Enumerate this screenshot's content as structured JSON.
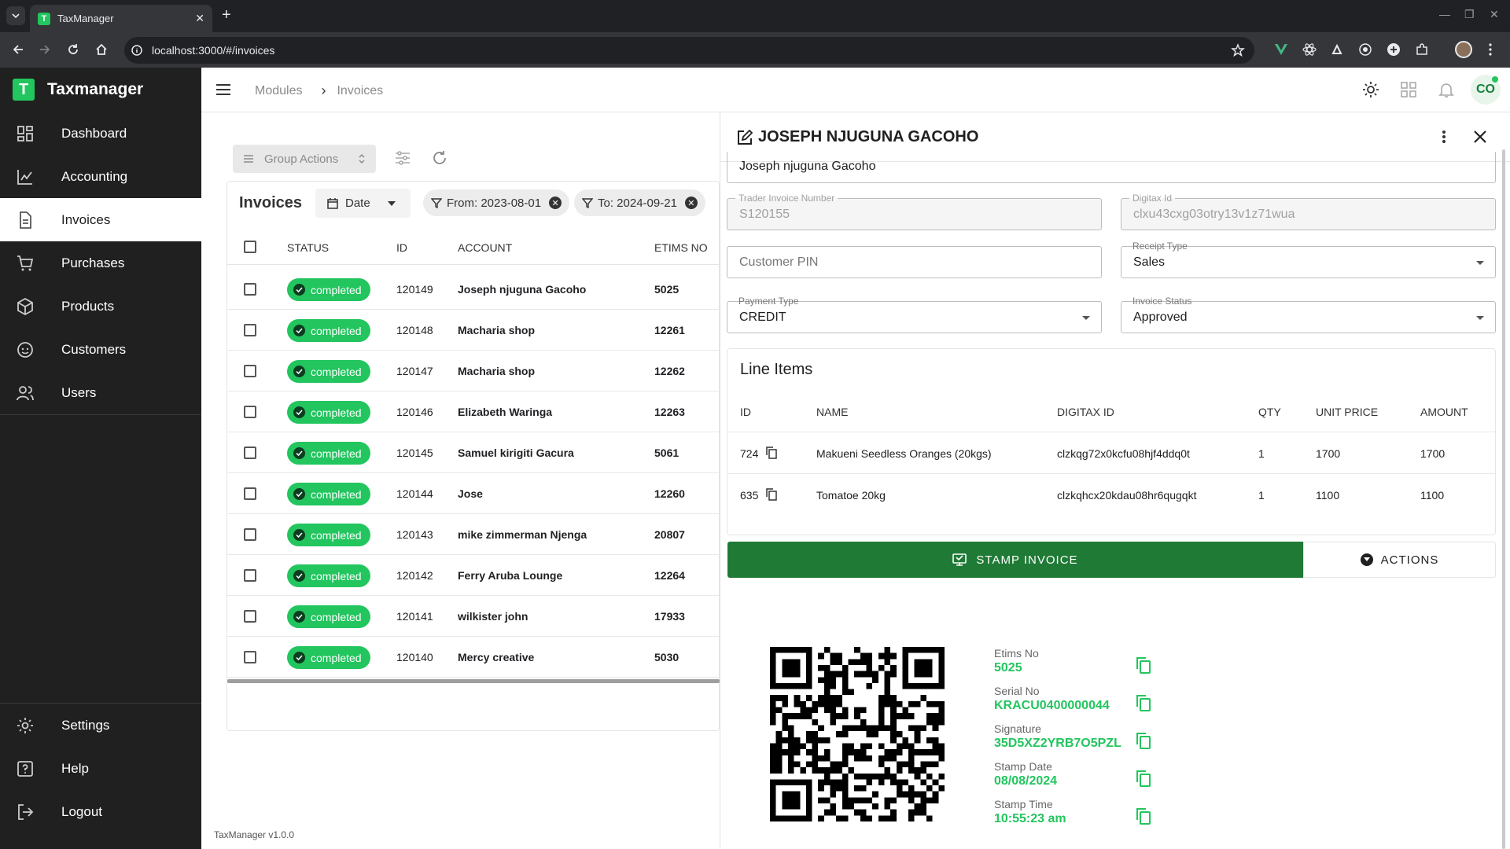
{
  "browser": {
    "tab_title": "TaxManager",
    "tab_favicon": "T",
    "url": "localhost:3000/#/invoices"
  },
  "app": {
    "brand": "Taxmanager",
    "brand_logo": "T",
    "version": "TaxManager v1.0.0"
  },
  "sidebar": {
    "items": [
      {
        "label": "Dashboard",
        "icon": "dashboard-icon"
      },
      {
        "label": "Accounting",
        "icon": "chart-icon"
      },
      {
        "label": "Invoices",
        "icon": "document-icon",
        "active": true
      },
      {
        "label": "Purchases",
        "icon": "cart-icon"
      },
      {
        "label": "Products",
        "icon": "cube-icon"
      },
      {
        "label": "Customers",
        "icon": "face-icon"
      },
      {
        "label": "Users",
        "icon": "users-icon"
      }
    ],
    "bottom": [
      {
        "label": "Settings",
        "icon": "gear-icon"
      },
      {
        "label": "Help",
        "icon": "help-icon"
      },
      {
        "label": "Logout",
        "icon": "logout-icon"
      }
    ]
  },
  "topbar": {
    "breadcrumb": [
      "Modules",
      "Invoices"
    ],
    "avatar": "CO"
  },
  "list": {
    "group_actions": "Group Actions",
    "title": "Invoices",
    "date_chip": "Date",
    "filters": [
      "From: 2023-08-01",
      "To: 2024-09-21"
    ],
    "columns": [
      "STATUS",
      "ID",
      "ACCOUNT",
      "ETIMS NO"
    ],
    "rows": [
      {
        "status": "completed",
        "id": "120149",
        "account": "Joseph njuguna Gacoho",
        "etims": "5025"
      },
      {
        "status": "completed",
        "id": "120148",
        "account": "Macharia shop",
        "etims": "12261"
      },
      {
        "status": "completed",
        "id": "120147",
        "account": "Macharia shop",
        "etims": "12262"
      },
      {
        "status": "completed",
        "id": "120146",
        "account": "Elizabeth Waringa",
        "etims": "12263"
      },
      {
        "status": "completed",
        "id": "120145",
        "account": "Samuel kirigiti Gacura",
        "etims": "5061"
      },
      {
        "status": "completed",
        "id": "120144",
        "account": "Jose",
        "etims": "12260"
      },
      {
        "status": "completed",
        "id": "120143",
        "account": "mike zimmerman Njenga",
        "etims": "20807"
      },
      {
        "status": "completed",
        "id": "120142",
        "account": "Ferry Aruba Lounge",
        "etims": "12264"
      },
      {
        "status": "completed",
        "id": "120141",
        "account": "wilkister john",
        "etims": "17933"
      },
      {
        "status": "completed",
        "id": "120140",
        "account": "Mercy creative",
        "etims": "5030"
      }
    ]
  },
  "drawer": {
    "title": "JOSEPH NJUGUNA GACOHO",
    "customer_name": "Joseph njuguna Gacoho",
    "trader_invoice_label": "Trader Invoice Number",
    "trader_invoice_value": "S120155",
    "digitax_label": "Digitax Id",
    "digitax_value": "clxu43cxg03otry13v1z71wua",
    "customer_pin_placeholder": "Customer PIN",
    "receipt_type_label": "Receipt Type",
    "receipt_type_value": "Sales",
    "payment_type_label": "Payment Type",
    "payment_type_value": "CREDIT",
    "invoice_status_label": "Invoice Status",
    "invoice_status_value": "Approved",
    "line_items": {
      "title": "Line Items",
      "columns": [
        "ID",
        "NAME",
        "DIGITAX ID",
        "QTY",
        "UNIT PRICE",
        "AMOUNT"
      ],
      "rows": [
        {
          "id": "724",
          "name": "Makueni Seedless Oranges (20kgs)",
          "digitax": "clzkqg72x0kcfu08hjf4ddq0t",
          "qty": "1",
          "unit_price": "1700",
          "amount": "1700"
        },
        {
          "id": "635",
          "name": "Tomatoe 20kg",
          "digitax": "clzkqhcx20kdau08hr6qugqkt",
          "qty": "1",
          "unit_price": "1100",
          "amount": "1100"
        }
      ]
    },
    "stamp_button": "STAMP INVOICE",
    "actions_button": "ACTIONS",
    "stamp_info": [
      {
        "label": "Etims No",
        "value": "5025"
      },
      {
        "label": "Serial No",
        "value": "KRACU0400000044"
      },
      {
        "label": "Signature",
        "value": "35D5XZ2YRB7O5PZL"
      },
      {
        "label": "Stamp Date",
        "value": "08/08/2024"
      },
      {
        "label": "Stamp Time",
        "value": "10:55:23 am"
      }
    ]
  },
  "colors": {
    "accent": "#22c55e",
    "sidebar_bg": "#202020",
    "stamp_button": "#1f7a35"
  }
}
